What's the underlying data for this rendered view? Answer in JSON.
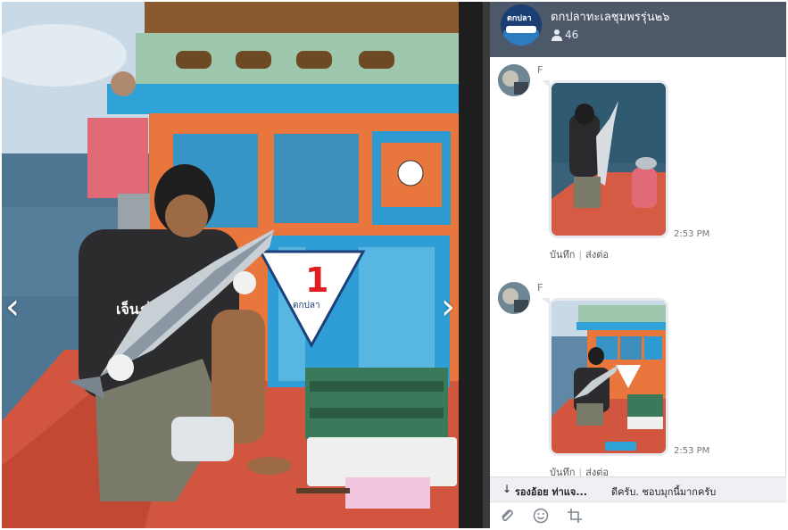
{
  "viewer": {
    "prev_glyph": "‹",
    "next_glyph": "›",
    "sign_number": "1",
    "sign_logo": "ตกปลา",
    "shirt_text": "เจ็นภูไ"
  },
  "chat": {
    "group_name": "ตกปลาทะเลชุมพรรุ่น๒๖",
    "member_count": "46",
    "group_avatar_text": "ตกปลา",
    "messages": [
      {
        "sender": "F",
        "time": "2:53 PM",
        "save_label": "บันทึก",
        "share_label": "ส่งต่อ"
      },
      {
        "sender": "F",
        "time": "2:53 PM",
        "save_label": "บันทึก",
        "share_label": "ส่งต่อ"
      }
    ],
    "notice": {
      "arrow": "↓",
      "name": "รองอ้อย ท่าแจ...",
      "text": "ดีครับ. ชอบมุกนี้มากครับ"
    },
    "icons": {
      "member": "person-icon",
      "attach": "paperclip-icon",
      "emoji": "smiley-icon",
      "crop": "crop-icon"
    }
  }
}
